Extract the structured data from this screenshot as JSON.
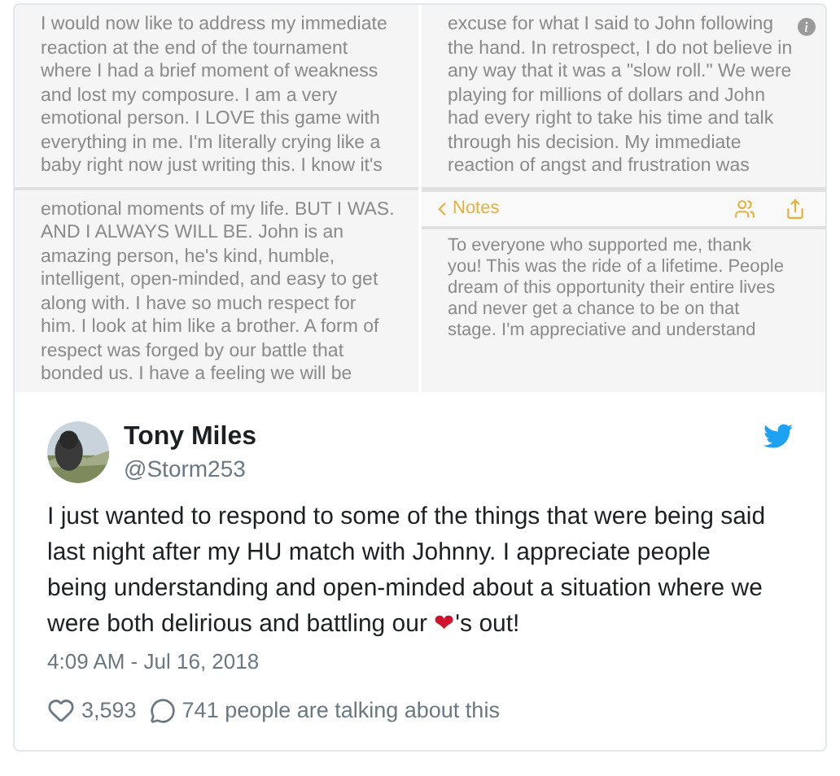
{
  "notes_image": {
    "columns": [
      {
        "panels": [
          {
            "kind": "text",
            "info_button": false,
            "lines": [
              "I would now like to address my immediate",
              "reaction at the end of the tournament",
              "where I had a brief moment of weakness",
              "and lost my composure. I am a very",
              "emotional person. I LOVE this game with",
              "everything in me. I'm literally crying like a",
              "baby right now just writing this. I know it's"
            ]
          },
          {
            "kind": "text",
            "info_button": false,
            "lines": [
              "emotional moments of my life. BUT I WAS.",
              "AND I ALWAYS WILL BE. John is an",
              "amazing person, he's kind, humble,",
              "intelligent, open-minded, and easy to get",
              "along with. I have so much respect for",
              "him. I look at him like a brother. A form of",
              "respect was forged by our battle that",
              "bonded us. I have a feeling we will be"
            ]
          }
        ]
      },
      {
        "panels": [
          {
            "kind": "text",
            "info_button": true,
            "lines": [
              "excuse for what I said to John following",
              "the hand. In retrospect, I do not believe in",
              "any way that it was a \"slow roll.\" We were",
              "playing for millions of dollars and John",
              "had every right to take his time and talk",
              "through his decision. My immediate",
              "reaction of angst and frustration was"
            ]
          },
          {
            "kind": "toolbar",
            "back_label": "Notes"
          },
          {
            "kind": "text",
            "info_button": false,
            "lines": [
              "To everyone who supported me, thank",
              "you! This was the ride of a lifetime. People",
              "dream of this opportunity their entire lives",
              "and never get a chance to be on that",
              "stage. I'm appreciative and understand"
            ]
          }
        ]
      }
    ]
  },
  "tweet": {
    "author": {
      "name": "Tony Miles",
      "handle": "@Storm253"
    },
    "text_before": "I just wanted to respond to some of the things that were being said last night after my HU match with Johnny. I appreciate people being understanding and open-minded about a situation where we were both delirious and battling our ",
    "heart": "❤",
    "text_after": "'s out!",
    "timestamp": "4:09 AM - Jul 16, 2018",
    "likes": "3,593",
    "talking": "741 people are talking about this"
  }
}
